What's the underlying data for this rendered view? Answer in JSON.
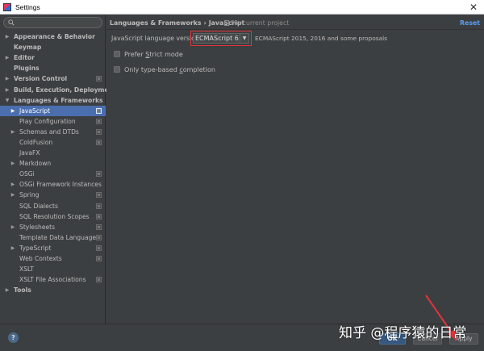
{
  "window": {
    "title": "Settings",
    "close_glyph": "✕"
  },
  "search": {
    "placeholder": "",
    "value": ""
  },
  "tree": [
    {
      "label": "Appearance & Behavior",
      "level": 0,
      "arrow": "▶",
      "bold": true,
      "project_icon": false,
      "selected": false
    },
    {
      "label": "Keymap",
      "level": 0,
      "arrow": "",
      "bold": true,
      "project_icon": false,
      "selected": false
    },
    {
      "label": "Editor",
      "level": 0,
      "arrow": "▶",
      "bold": true,
      "project_icon": false,
      "selected": false
    },
    {
      "label": "Plugins",
      "level": 0,
      "arrow": "",
      "bold": true,
      "project_icon": false,
      "selected": false
    },
    {
      "label": "Version Control",
      "level": 0,
      "arrow": "▶",
      "bold": true,
      "project_icon": true,
      "selected": false
    },
    {
      "label": "Build, Execution, Deployment",
      "level": 0,
      "arrow": "▶",
      "bold": true,
      "project_icon": false,
      "selected": false
    },
    {
      "label": "Languages & Frameworks",
      "level": 0,
      "arrow": "▼",
      "bold": true,
      "project_icon": false,
      "selected": false
    },
    {
      "label": "JavaScript",
      "level": 1,
      "arrow": "▶",
      "bold": false,
      "project_icon": true,
      "selected": true
    },
    {
      "label": "Play Configuration",
      "level": 1,
      "arrow": "",
      "bold": false,
      "project_icon": true,
      "selected": false
    },
    {
      "label": "Schemas and DTDs",
      "level": 1,
      "arrow": "▶",
      "bold": false,
      "project_icon": true,
      "selected": false
    },
    {
      "label": "ColdFusion",
      "level": 1,
      "arrow": "",
      "bold": false,
      "project_icon": true,
      "selected": false
    },
    {
      "label": "JavaFX",
      "level": 1,
      "arrow": "",
      "bold": false,
      "project_icon": false,
      "selected": false
    },
    {
      "label": "Markdown",
      "level": 1,
      "arrow": "▶",
      "bold": false,
      "project_icon": false,
      "selected": false
    },
    {
      "label": "OSGi",
      "level": 1,
      "arrow": "",
      "bold": false,
      "project_icon": true,
      "selected": false
    },
    {
      "label": "OSGi Framework Instances",
      "level": 1,
      "arrow": "▶",
      "bold": false,
      "project_icon": false,
      "selected": false
    },
    {
      "label": "Spring",
      "level": 1,
      "arrow": "▶",
      "bold": false,
      "project_icon": true,
      "selected": false
    },
    {
      "label": "SQL Dialects",
      "level": 1,
      "arrow": "",
      "bold": false,
      "project_icon": true,
      "selected": false
    },
    {
      "label": "SQL Resolution Scopes",
      "level": 1,
      "arrow": "",
      "bold": false,
      "project_icon": true,
      "selected": false
    },
    {
      "label": "Stylesheets",
      "level": 1,
      "arrow": "▶",
      "bold": false,
      "project_icon": true,
      "selected": false
    },
    {
      "label": "Template Data Languages",
      "level": 1,
      "arrow": "",
      "bold": false,
      "project_icon": true,
      "selected": false
    },
    {
      "label": "TypeScript",
      "level": 1,
      "arrow": "▶",
      "bold": false,
      "project_icon": true,
      "selected": false
    },
    {
      "label": "Web Contexts",
      "level": 1,
      "arrow": "",
      "bold": false,
      "project_icon": true,
      "selected": false
    },
    {
      "label": "XSLT",
      "level": 1,
      "arrow": "",
      "bold": false,
      "project_icon": false,
      "selected": false
    },
    {
      "label": "XSLT File Associations",
      "level": 1,
      "arrow": "",
      "bold": false,
      "project_icon": true,
      "selected": false
    },
    {
      "label": "Tools",
      "level": 0,
      "arrow": "▶",
      "bold": true,
      "project_icon": false,
      "selected": false
    }
  ],
  "header": {
    "breadcrumb_parent": "Languages & Frameworks",
    "breadcrumb_sep": "›",
    "breadcrumb_current": "JavaScript",
    "scope_note": "For current project",
    "reset_label": "Reset"
  },
  "settings": {
    "language_version_label": "JavaScript language version",
    "language_version_value": "ECMAScript 6",
    "language_version_desc": "ECMAScript 2015, 2016 and some proposals",
    "prefer_strict_pre": "Prefer ",
    "prefer_strict_ul": "S",
    "prefer_strict_post": "trict mode",
    "prefer_strict_checked": false,
    "type_based_pre": "Only type-based ",
    "type_based_ul": "c",
    "type_based_post": "ompletion",
    "type_based_checked": false
  },
  "footer": {
    "help_glyph": "?",
    "ok_label": "OK",
    "cancel_label": "Cancel",
    "apply_label": "Apply"
  },
  "watermark": {
    "text": "知乎 @程序猿的日常"
  },
  "colors": {
    "selection": "#4b6eaf",
    "highlight_box": "#e0353b",
    "arrow_annotation": "#e0353b",
    "reset_link": "#589df6"
  }
}
